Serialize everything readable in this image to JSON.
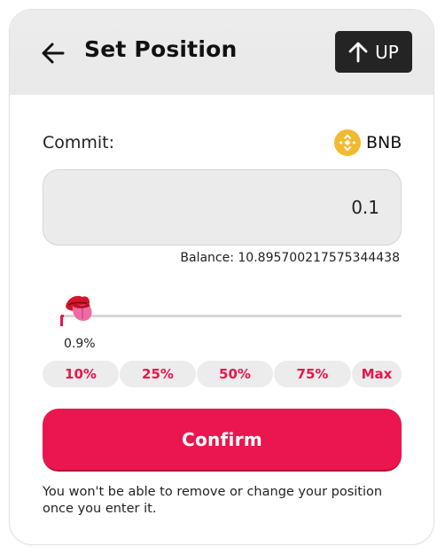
{
  "header": {
    "title": "Set Position",
    "direction_label": "UP"
  },
  "commit": {
    "label": "Commit:",
    "token_name": "BNB",
    "amount_value": "0.1",
    "balance_text": "Balance: 10.895700217575344438"
  },
  "slider": {
    "value_text": "0.9%",
    "value_fraction": 0.009
  },
  "percent_buttons": [
    "10%",
    "25%",
    "50%",
    "75%",
    "Max"
  ],
  "confirm_label": "Confirm",
  "note": "You won't be able to remove or change your position once you enter it.",
  "colors": {
    "accent": "#eb164f",
    "bnb": "#f3ba2f",
    "header_bg": "#ececec",
    "badge_bg": "#242424"
  },
  "icons": {
    "back": "arrow-left-icon",
    "direction": "arrow-up-icon",
    "token": "bnb-logo-icon",
    "slider_thumb": "tongue-lips-icon"
  }
}
